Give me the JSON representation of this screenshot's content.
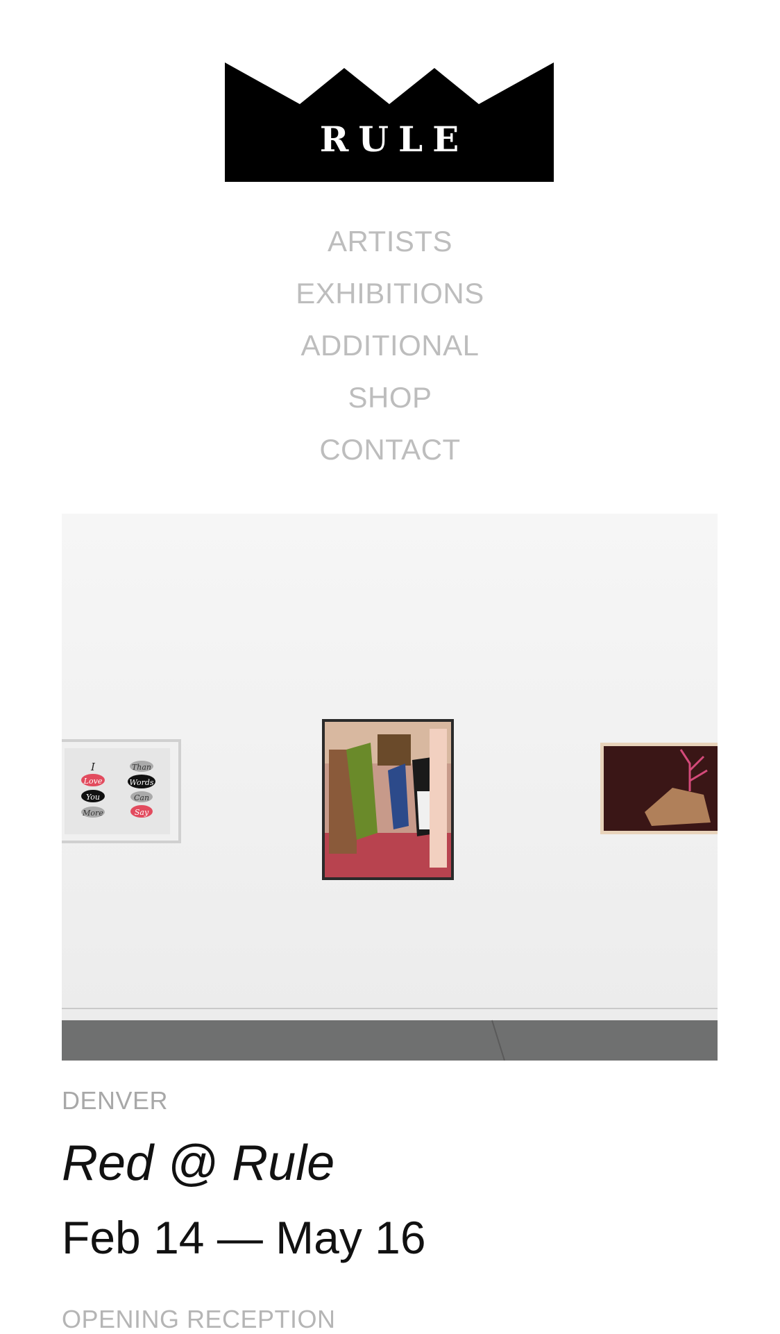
{
  "brand": {
    "logo_text": "RULE",
    "logo_color": "#000000"
  },
  "nav": {
    "items": [
      {
        "label": "ARTISTS"
      },
      {
        "label": "EXHIBITIONS"
      },
      {
        "label": "ADDITIONAL"
      },
      {
        "label": "SHOP"
      },
      {
        "label": "CONTACT"
      }
    ],
    "color": "#bdbdbd"
  },
  "hero": {
    "left_painting_text": [
      "I",
      "Love",
      "You",
      "More",
      "Than",
      "Words",
      "Can",
      "Say"
    ]
  },
  "exhibition": {
    "location": "DENVER",
    "title": "Red @ Rule",
    "dates": "Feb 14 — May 16",
    "next_section": "OPENING RECEPTION"
  }
}
